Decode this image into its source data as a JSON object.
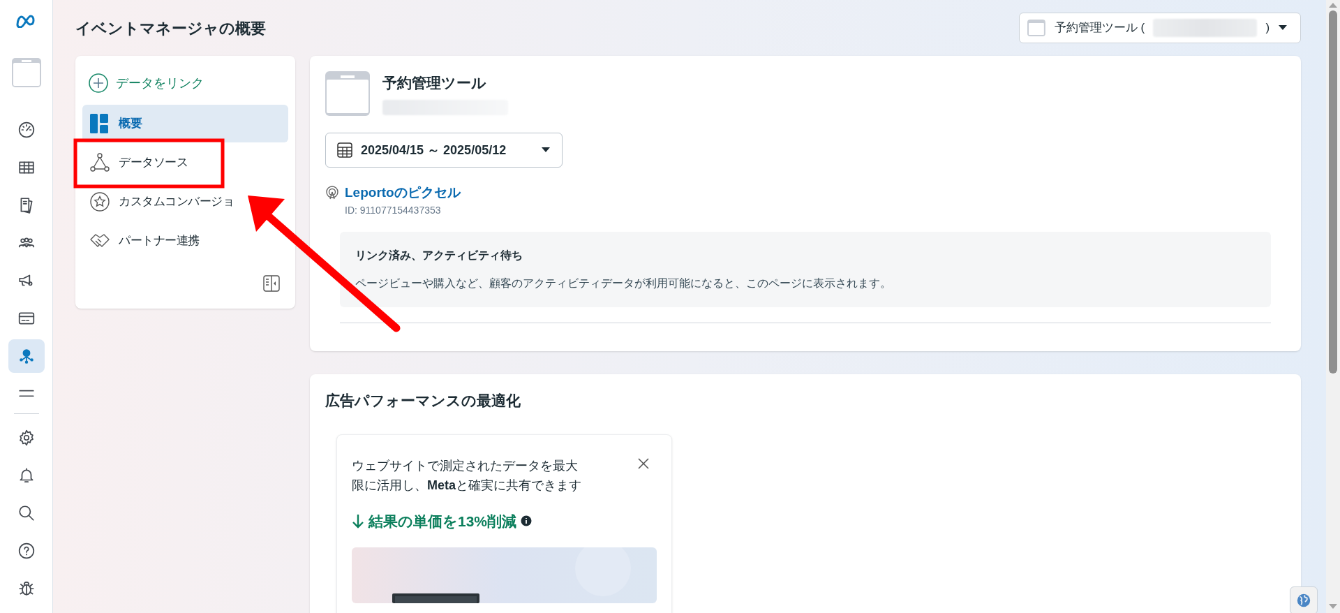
{
  "rail": {
    "items": [
      {
        "kind": "gauge",
        "selected": false
      },
      {
        "kind": "table",
        "selected": false
      },
      {
        "kind": "pages",
        "selected": false
      },
      {
        "kind": "people",
        "selected": false
      },
      {
        "kind": "megaphone",
        "selected": false
      },
      {
        "kind": "card",
        "selected": false
      },
      {
        "kind": "network",
        "selected": true
      },
      {
        "kind": "menu",
        "selected": false
      }
    ],
    "bottom": [
      {
        "kind": "gear"
      },
      {
        "kind": "bell"
      },
      {
        "kind": "search"
      },
      {
        "kind": "help"
      },
      {
        "kind": "bug"
      }
    ]
  },
  "header": {
    "title": "イベントマネージャの概要"
  },
  "account_dropdown": {
    "label": "予約管理ツール (",
    "suffix": ")"
  },
  "sidebar": {
    "link_action": "データをリンク",
    "items": [
      {
        "label": "概要",
        "kind": "overview",
        "selected": true
      },
      {
        "label": "データソース",
        "kind": "sources",
        "selected": false
      },
      {
        "label": "カスタムコンバージョ",
        "kind": "star",
        "selected": false
      },
      {
        "label": "パートナー連携",
        "kind": "handshake",
        "selected": false
      }
    ]
  },
  "dataset_card": {
    "title": "予約管理ツール",
    "date_range": "2025/04/15 ～ 2025/05/12",
    "pixel": {
      "name": "Leportoのピクセル",
      "id": "ID: 911077154437353"
    },
    "notice": {
      "title": "リンク済み、アクティビティ待ち",
      "body": "ページビューや購入など、顧客のアクティビティデータが利用可能になると、このページに表示されます。"
    }
  },
  "optimization": {
    "title": "広告パフォーマンスの最適化",
    "tip": {
      "text": "ウェブサイトで測定されたデータを最大限に活用し、**Meta**と確実に共有できます",
      "result": "結果の単価を13%削減"
    }
  },
  "annotation": {
    "highlight_frame": true,
    "pointer_arrow": true
  }
}
